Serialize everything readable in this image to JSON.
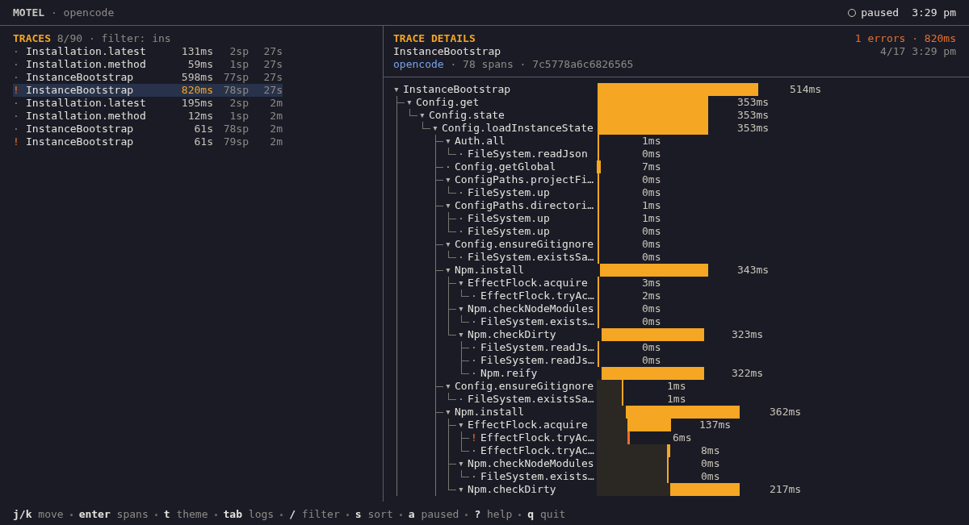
{
  "title_bar": {
    "app": "MOTEL",
    "context": "· opencode",
    "status": "paused",
    "time": "3:29 pm"
  },
  "traces": {
    "title": "TRACES",
    "meta": "8/90 · filter: ins",
    "rows": [
      {
        "marker": "·",
        "error": false,
        "name": "Installation.latest",
        "duration": "131ms",
        "spans": "2sp",
        "age": "27s",
        "selected": false
      },
      {
        "marker": "·",
        "error": false,
        "name": "Installation.method",
        "duration": "59ms",
        "spans": "1sp",
        "age": "27s",
        "selected": false
      },
      {
        "marker": "·",
        "error": false,
        "name": "InstanceBootstrap",
        "duration": "598ms",
        "spans": "77sp",
        "age": "27s",
        "selected": false
      },
      {
        "marker": "!",
        "error": true,
        "name": "InstanceBootstrap",
        "duration": "820ms",
        "spans": "78sp",
        "age": "27s",
        "selected": true
      },
      {
        "marker": "·",
        "error": false,
        "name": "Installation.latest",
        "duration": "195ms",
        "spans": "2sp",
        "age": "2m",
        "selected": false
      },
      {
        "marker": "·",
        "error": false,
        "name": "Installation.method",
        "duration": "12ms",
        "spans": "1sp",
        "age": "2m",
        "selected": false
      },
      {
        "marker": "·",
        "error": false,
        "name": "InstanceBootstrap",
        "duration": "61s",
        "spans": "78sp",
        "age": "2m",
        "selected": false
      },
      {
        "marker": "!",
        "error": true,
        "name": "InstanceBootstrap",
        "duration": "61s",
        "spans": "79sp",
        "age": "2m",
        "selected": false
      }
    ]
  },
  "details": {
    "title": "TRACE DETAILS",
    "summary": "1 errors · 820ms",
    "trace_name": "InstanceBootstrap",
    "date": "4/17 3:29 pm",
    "service": "opencode",
    "info": "· 78 spans · 7c5778a6c6826565",
    "spans": [
      {
        "marker": "▾",
        "error": false,
        "name": "InstanceBootstrap",
        "duration": "514ms",
        "has_more_below": true,
        "children": [
          {
            "marker": "▾",
            "error": false,
            "name": "Config.get",
            "duration": "353ms",
            "children": [
              {
                "marker": "▾",
                "error": false,
                "name": "Config.state",
                "duration": "353ms",
                "children": [
                  {
                    "marker": "▾",
                    "error": false,
                    "name": "Config.loadInstanceState",
                    "duration": "353ms",
                    "has_more_below": true,
                    "children": [
                      {
                        "marker": "▾",
                        "error": false,
                        "name": "Auth.all",
                        "duration": "1ms",
                        "children": [
                          {
                            "marker": "·",
                            "error": false,
                            "name": "FileSystem.readJson",
                            "duration": "0ms"
                          }
                        ]
                      },
                      {
                        "marker": "·",
                        "error": false,
                        "name": "Config.getGlobal",
                        "duration": "7ms"
                      },
                      {
                        "marker": "▾",
                        "error": false,
                        "name": "ConfigPaths.projectFi…",
                        "duration": "0ms",
                        "children": [
                          {
                            "marker": "·",
                            "error": false,
                            "name": "FileSystem.up",
                            "duration": "0ms"
                          }
                        ]
                      },
                      {
                        "marker": "▾",
                        "error": false,
                        "name": "ConfigPaths.directori…",
                        "duration": "1ms",
                        "children": [
                          {
                            "marker": "·",
                            "error": false,
                            "name": "FileSystem.up",
                            "duration": "1ms"
                          },
                          {
                            "marker": "·",
                            "error": false,
                            "name": "FileSystem.up",
                            "duration": "0ms"
                          }
                        ]
                      },
                      {
                        "marker": "▾",
                        "error": false,
                        "name": "Config.ensureGitignore",
                        "duration": "0ms",
                        "children": [
                          {
                            "marker": "·",
                            "error": false,
                            "name": "FileSystem.existsSa…",
                            "duration": "0ms"
                          }
                        ]
                      },
                      {
                        "marker": "▾",
                        "error": false,
                        "name": "Npm.install",
                        "duration": "343ms",
                        "children": [
                          {
                            "marker": "▾",
                            "error": false,
                            "name": "EffectFlock.acquire",
                            "duration": "3ms",
                            "children": [
                              {
                                "marker": "·",
                                "error": false,
                                "name": "EffectFlock.tryAc…",
                                "duration": "2ms"
                              }
                            ]
                          },
                          {
                            "marker": "▾",
                            "error": false,
                            "name": "Npm.checkNodeModules",
                            "duration": "0ms",
                            "children": [
                              {
                                "marker": "·",
                                "error": false,
                                "name": "FileSystem.exists…",
                                "duration": "0ms"
                              }
                            ]
                          },
                          {
                            "marker": "▾",
                            "error": false,
                            "name": "Npm.checkDirty",
                            "duration": "323ms",
                            "children": [
                              {
                                "marker": "·",
                                "error": false,
                                "name": "FileSystem.readJs…",
                                "duration": "0ms"
                              },
                              {
                                "marker": "·",
                                "error": false,
                                "name": "FileSystem.readJs…",
                                "duration": "0ms"
                              },
                              {
                                "marker": "·",
                                "error": false,
                                "name": "Npm.reify",
                                "duration": "322ms"
                              }
                            ]
                          }
                        ]
                      },
                      {
                        "marker": "▾",
                        "error": false,
                        "name": "Config.ensureGitignore",
                        "duration": "1ms",
                        "children": [
                          {
                            "marker": "·",
                            "error": false,
                            "name": "FileSystem.existsSa…",
                            "duration": "1ms"
                          }
                        ]
                      },
                      {
                        "marker": "▾",
                        "error": false,
                        "name": "Npm.install",
                        "duration": "362ms",
                        "children": [
                          {
                            "marker": "▾",
                            "error": false,
                            "name": "EffectFlock.acquire",
                            "duration": "137ms",
                            "children": [
                              {
                                "marker": "!",
                                "error": true,
                                "name": "EffectFlock.tryAc…",
                                "duration": "6ms"
                              },
                              {
                                "marker": "·",
                                "error": false,
                                "name": "EffectFlock.tryAc…",
                                "duration": "8ms"
                              }
                            ]
                          },
                          {
                            "marker": "▾",
                            "error": false,
                            "name": "Npm.checkNodeModules",
                            "duration": "0ms",
                            "children": [
                              {
                                "marker": "·",
                                "error": false,
                                "name": "FileSystem.exists…",
                                "duration": "0ms"
                              }
                            ]
                          },
                          {
                            "marker": "▾",
                            "error": false,
                            "name": "Npm.checkDirty",
                            "duration": "217ms"
                          }
                        ]
                      }
                    ]
                  }
                ]
              }
            ]
          }
        ]
      }
    ]
  },
  "help": [
    {
      "key": "j/k",
      "label": "move"
    },
    {
      "key": "enter",
      "label": "spans"
    },
    {
      "key": "t",
      "label": "theme"
    },
    {
      "key": "tab",
      "label": "logs"
    },
    {
      "key": "/",
      "label": "filter"
    },
    {
      "key": "s",
      "label": "sort"
    },
    {
      "key": "a",
      "label": "paused"
    },
    {
      "key": "?",
      "label": "help"
    },
    {
      "key": "q",
      "label": "quit"
    }
  ]
}
